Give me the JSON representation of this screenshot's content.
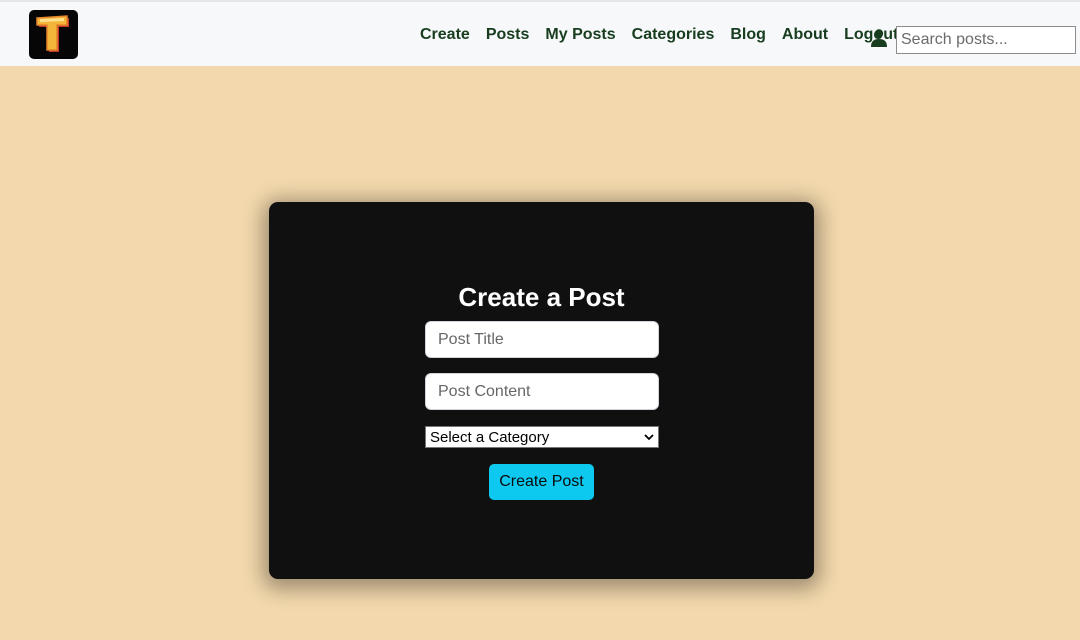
{
  "brand": {
    "logo_letter": "T"
  },
  "nav": {
    "items": [
      {
        "label": "Create"
      },
      {
        "label": "Posts"
      },
      {
        "label": "My Posts"
      },
      {
        "label": "Categories"
      },
      {
        "label": "Blog"
      },
      {
        "label": "About"
      },
      {
        "label": "Logout"
      }
    ],
    "user_icon": "user-icon",
    "search_placeholder": "Search posts..."
  },
  "form": {
    "title": "Create a Post",
    "title_placeholder": "Post Title",
    "content_placeholder": "Post Content",
    "category_selected": "Select a Category",
    "submit_label": "Create Post"
  },
  "colors": {
    "page_bg": "#f2d8ac",
    "navbar_bg": "#f7f8fa",
    "nav_text": "#173d1e",
    "card_bg": "#101010",
    "button": "#0dc9ef"
  }
}
